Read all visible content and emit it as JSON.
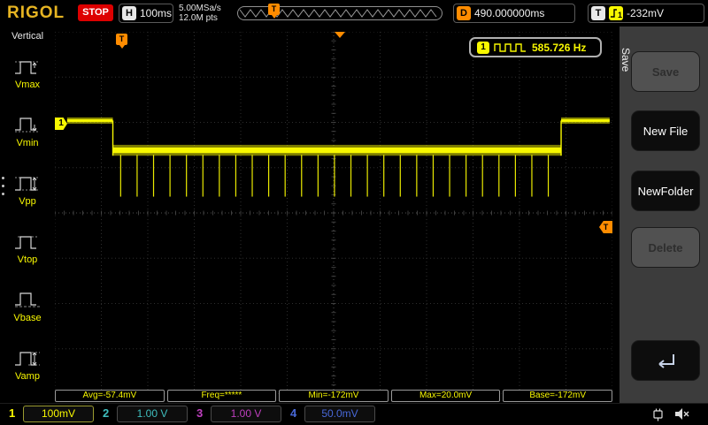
{
  "header": {
    "logo": "RIGOL",
    "run_state": "STOP",
    "horizontal": {
      "label": "H",
      "scale": "100ms"
    },
    "acquisition": {
      "sample_rate": "5.00MSa/s",
      "memory_depth": "12.0M pts"
    },
    "delay": {
      "label": "D",
      "value": "490.000000ms"
    },
    "trigger": {
      "label": "T",
      "channel": "1",
      "level": "-232mV"
    }
  },
  "left_menu": {
    "title": "Vertical",
    "items": [
      {
        "label": "Vmax"
      },
      {
        "label": "Vmin"
      },
      {
        "label": "Vpp"
      },
      {
        "label": "Vtop"
      },
      {
        "label": "Vbase"
      },
      {
        "label": "Vamp"
      }
    ]
  },
  "right_menu": {
    "tab": "Save",
    "buttons": [
      {
        "label": "Save",
        "enabled": false
      },
      {
        "label": "New File",
        "enabled": true
      },
      {
        "label": "NewFolder",
        "enabled": true
      },
      {
        "label": "Delete",
        "enabled": false
      },
      {
        "label": "",
        "enabled": true,
        "icon": "return-arrow"
      }
    ]
  },
  "freq_counter": {
    "channel": "1",
    "value": "585.726 Hz"
  },
  "measurements": [
    "Avg=-57.4mV",
    "Freq=*****",
    "Min=-172mV",
    "Max=20.0mV",
    "Base=-172mV"
  ],
  "channels": [
    {
      "num": "1",
      "scale": "100mV",
      "color": "#f8f800",
      "active": true
    },
    {
      "num": "2",
      "scale": "1.00 V",
      "color": "#3fbfbf",
      "active": false
    },
    {
      "num": "3",
      "scale": "1.00 V",
      "color": "#bf3fbf",
      "active": false
    },
    {
      "num": "4",
      "scale": "50.0mV",
      "color": "#4868d8",
      "active": false
    }
  ],
  "colors": {
    "accent_orange": "#ff8c00",
    "trace_yellow": "#f8f800",
    "grid_line": "#2e2e2e",
    "grid_center": "#4d4d4d"
  },
  "chart_data": {
    "type": "line",
    "title": "CH1 oscilloscope trace",
    "timebase_per_div": "100ms",
    "vertical_scale_per_div": "100mV",
    "measured": {
      "avg_mV": -57.4,
      "min_mV": -172,
      "max_mV": 20.0,
      "base_mV": -172,
      "freq_counter_hz": 585.726
    },
    "shape": {
      "description": "High idle level, falling to a low noisy base with 27 narrow negative spikes, then returning to high level",
      "high_y": 0.245,
      "low_top_y": 0.312,
      "low_bot_y": 0.342,
      "spike_tip_y": 0.455,
      "trace_start_x": 0.022,
      "fall_x": 0.104,
      "rise_x": 0.908,
      "trace_end_x": 0.995,
      "first_spike_x": 0.118,
      "last_spike_x": 0.885,
      "spike_count": 27
    }
  }
}
